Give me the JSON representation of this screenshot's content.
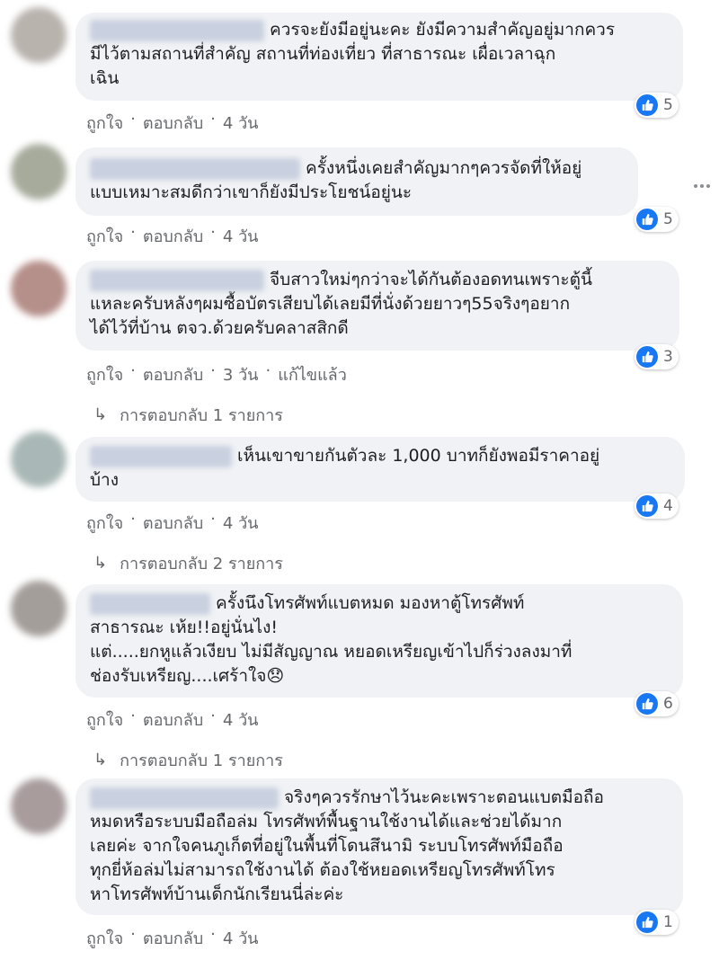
{
  "comments": [
    {
      "text": "ควรจะยังมีอยู่นะคะ ยังมีความสำคัญอยู่มากควร\nมีไว้ตามสถานที่สำคัญ สถานที่ท่องเที่ยว ที่สาธารณะ เผื่อเวลาฉุก\nเฉิน",
      "reactions": "5",
      "like_label": "ถูกใจ",
      "reply_label": "ตอบกลับ",
      "time": "4 วัน",
      "edited": "",
      "replies_label": ""
    },
    {
      "text": "ครั้งหนึ่งเคยสำคัญมากๆควรจัดที่ให้อยู่\nแบบเหมาะสมดีกว่าเขาก็ยังมีประโยชน์อยู่นะ",
      "reactions": "5",
      "like_label": "ถูกใจ",
      "reply_label": "ตอบกลับ",
      "time": "4 วัน",
      "edited": "",
      "replies_label": ""
    },
    {
      "text": "จีบสาวใหม่ๆกว่าจะได้กันต้องอดทนเพราะตู้นี้\nแหละครับหลังๆผมซื้อบัตรเสียบได้เลยมีที่นั่งด้วยยาวๆ55จริงๆอยาก\nได้ไว้ที่บ้าน ตจว.ด้วยครับคลาสสิกดี",
      "reactions": "3",
      "like_label": "ถูกใจ",
      "reply_label": "ตอบกลับ",
      "time": "3 วัน",
      "edited": "แก้ไขแล้ว",
      "replies_label": "การตอบกลับ 1 รายการ"
    },
    {
      "text": "เห็นเขาขายกันตัวละ 1,000 บาทก็ยังพอมีราคาอยู่\nบ้าง",
      "reactions": "4",
      "like_label": "ถูกใจ",
      "reply_label": "ตอบกลับ",
      "time": "4 วัน",
      "edited": "",
      "replies_label": "การตอบกลับ 2 รายการ"
    },
    {
      "text": "ครั้งนึงโทรศัพท์แบตหมด มองหาตู้โทรศัพท์\nสาธารณะ เห้ย!!อยู่นั่นไง!\nแต่.....ยกหูแล้วเงียบ ไม่มีสัญญาณ หยอดเหรียญเข้าไปก็ร่วงลงมาที่\nช่องรับเหรียญ....เศร้าใจ😞",
      "reactions": "6",
      "like_label": "ถูกใจ",
      "reply_label": "ตอบกลับ",
      "time": "4 วัน",
      "edited": "",
      "replies_label": "การตอบกลับ 1 รายการ"
    },
    {
      "text": "จริงๆควรรักษาไว้นะคะเพราะตอนแบตมือถือ\nหมดหรือระบบมือถือล่ม โทรศัพท์พื้นฐานใช้งานได้และช่วยได้มาก\nเลยค่ะ จากใจคนภูเก็ตที่อยู่ในพื้นที่โดนสึนามิ ระบบโทรศัพท์มือถือ\nทุกยี่ห้อล่มไม่สามารถใช้งานได้ ต้องใช้หยอดเหรียญโทรศัพท์โทร\nหาโทรศัพท์บ้านเด็กนักเรียนนี่ล่ะค่ะ",
      "reactions": "1",
      "like_label": "ถูกใจ",
      "reply_label": "ตอบกลับ",
      "time": "4 วัน",
      "edited": "",
      "replies_label": ""
    }
  ]
}
